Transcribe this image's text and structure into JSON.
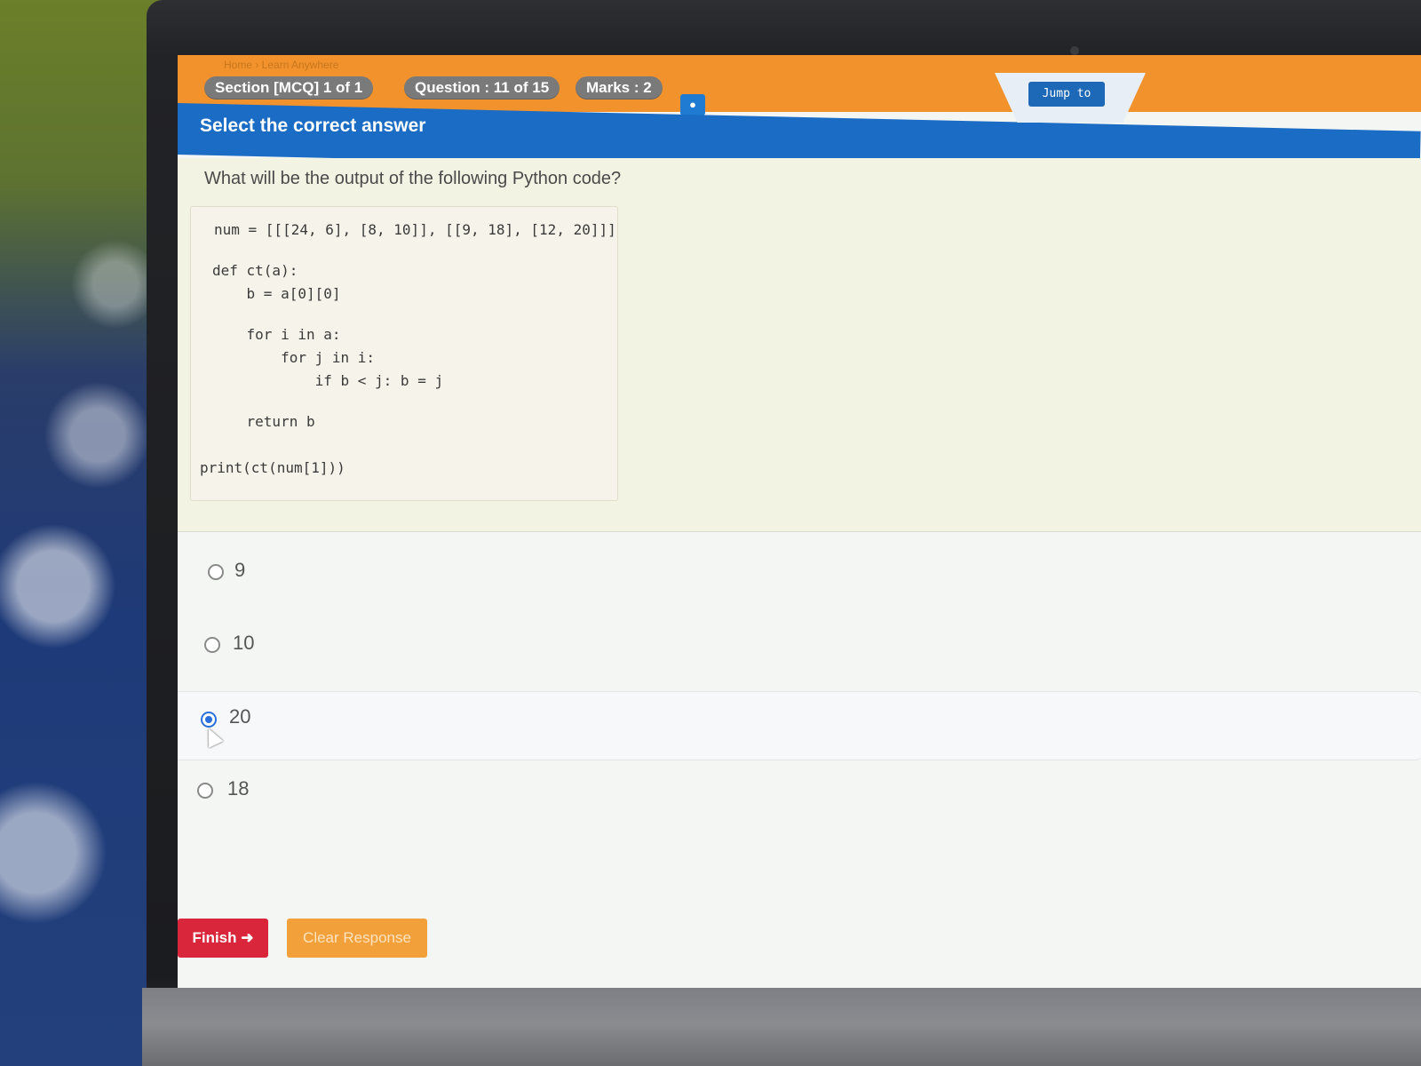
{
  "header": {
    "breadcrumb": "Home  ›  Learn Anywhere",
    "section_label": "Section [MCQ] 1 of 1",
    "question_label": "Question : 11 of 15",
    "marks_label": "Marks : 2",
    "jump_label": "Jump to",
    "instruction": "Select the correct answer"
  },
  "question": {
    "prompt": "What will be the output of the following Python code?",
    "code": [
      "num = [[[24, 6], [8, 10]], [[9, 18], [12, 20]]]",
      "def ct(a):",
      "    b = a[0][0]",
      "    for i in a:",
      "        for j in i:",
      "            if b < j: b = j",
      "    return b",
      "print(ct(num[1]))"
    ]
  },
  "options": [
    {
      "label": "9",
      "selected": false
    },
    {
      "label": "10",
      "selected": false
    },
    {
      "label": "20",
      "selected": true
    },
    {
      "label": "18",
      "selected": false
    }
  ],
  "actions": {
    "finish_label": "Finish",
    "finish_icon": "sign-out-icon",
    "clear_label": "Clear Response"
  },
  "colors": {
    "orange": "#f2922c",
    "blue": "#1b6cc4",
    "finish": "#d9263a",
    "clear": "#f2a03a"
  }
}
